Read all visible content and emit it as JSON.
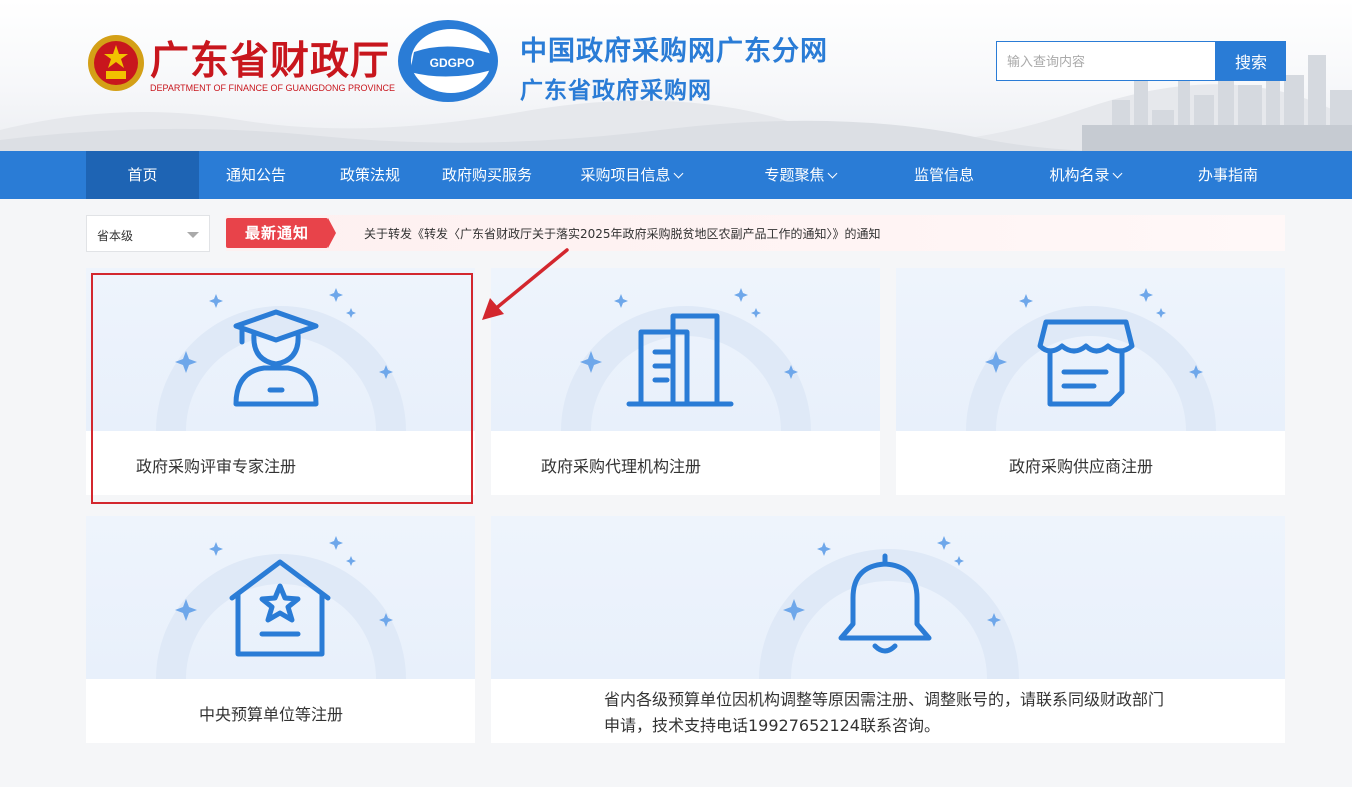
{
  "header": {
    "dept_name": "广东省财政厅",
    "dept_name_en": "DEPARTMENT OF FINANCE OF GUANGDONG PROVINCE",
    "logo_text": "GDGPO",
    "site_title_1": "中国政府采购网广东分网",
    "site_title_2": "广东省政府采购网",
    "search_placeholder": "输入查询内容",
    "search_button": "搜索"
  },
  "nav": {
    "items": [
      {
        "label": "首页"
      },
      {
        "label": "通知公告"
      },
      {
        "label": "政策法规"
      },
      {
        "label": "政府购买服务"
      },
      {
        "label": "采购项目信息"
      },
      {
        "label": "专题聚焦"
      },
      {
        "label": "监管信息"
      },
      {
        "label": "机构名录"
      },
      {
        "label": "办事指南"
      }
    ]
  },
  "notice": {
    "level_select": "省本级",
    "tag": "最新通知",
    "text": "关于转发《转发〈广东省财政厅关于落实2025年政府采购脱贫地区农副产品工作的通知〉》的通知"
  },
  "cards": [
    {
      "label": "政府采购评审专家注册",
      "icon": "expert-icon"
    },
    {
      "label": "政府采购代理机构注册",
      "icon": "building-icon"
    },
    {
      "label": "政府采购供应商注册",
      "icon": "shop-icon"
    },
    {
      "label": "中央预算单位等注册",
      "icon": "star-house-icon"
    },
    {
      "label": "省内各级预算单位因机构调整等原因需注册、调整账号的，请联系同级财政部门申请，技术支持电话19927652124联系咨询。",
      "icon": "bell-icon"
    }
  ],
  "colors": {
    "primary": "#2a7cd6",
    "nav_active": "#1e64b4",
    "brand_red": "#c8161d",
    "notice_red": "#e8434a",
    "highlight_red": "#d3272e"
  }
}
